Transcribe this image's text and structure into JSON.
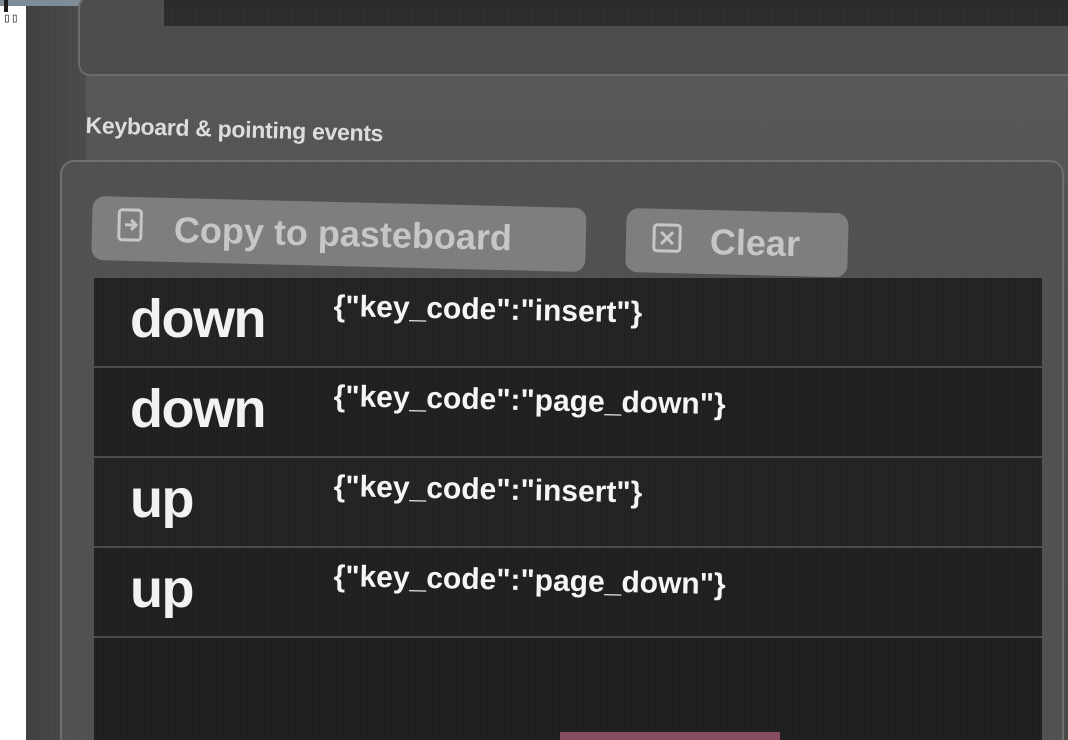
{
  "corner_glyphs": "▯▯",
  "section": {
    "title": "Keyboard & pointing events"
  },
  "toolbar": {
    "copy_label": "Copy to pasteboard",
    "copy_icon": "copy-to-pasteboard-icon",
    "clear_label": "Clear",
    "clear_icon": "clear-x-box-icon"
  },
  "events": [
    {
      "type": "down",
      "payload": "{\"key_code\":\"insert\"}"
    },
    {
      "type": "down",
      "payload": "{\"key_code\":\"page_down\"}"
    },
    {
      "type": "up",
      "payload": "{\"key_code\":\"insert\"}"
    },
    {
      "type": "up",
      "payload": "{\"key_code\":\"page_down\"}"
    }
  ],
  "colors": {
    "panel_bg": "#505050",
    "list_bg": "#1e1e1e",
    "button_bg": "#7d7d7d",
    "text_light": "#f2f2f2"
  }
}
